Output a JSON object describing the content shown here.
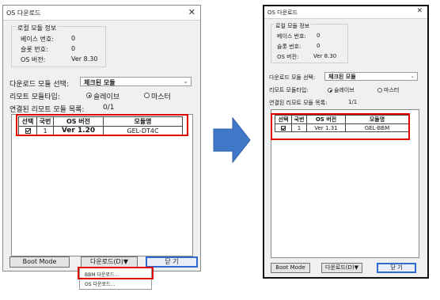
{
  "left": {
    "title": "OS 다운로드",
    "close": "✕",
    "local_group": "로컬 모듈 정보",
    "base_label": "베이스 번호:",
    "base_value": "0",
    "slot_label": "슬롯 번호:",
    "slot_value": "0",
    "os_label": "OS 버전:",
    "os_value": "Ver 8.30",
    "module_select_label": "다운로드 모듈 선택:",
    "module_select_value": "체크된 모듈",
    "remote_type_label": "리모트 모듈타입:",
    "radio_slave": "슬레이브",
    "radio_master": "마스터",
    "connected_label": "연결된 리모트 모듈 목록:",
    "connected_value": "0/1",
    "columns": [
      "선택",
      "국번",
      "OS 버전",
      "모듈명"
    ],
    "rows": [
      {
        "station": "1",
        "os": "Ver 1.20",
        "module": "GEL-DT4C"
      }
    ],
    "boot_button": "Boot Mode",
    "download_button": "다운로드(D)▼",
    "close_button": "닫 기",
    "menu_items": [
      "BBM 다운로드...",
      "OS 다운로드..."
    ]
  },
  "right": {
    "title": "OS 다운로드",
    "close": "✕",
    "local_group": "로컬 모듈 정보",
    "base_label": "베이스 번호:",
    "base_value": "0",
    "slot_label": "슬롯 번호:",
    "slot_value": "0",
    "os_label": "OS 버전:",
    "os_value": "Ver 8.30",
    "module_select_label": "다운로드 모듈 선택:",
    "module_select_value": "체크된 모듈",
    "remote_type_label": "리모트 모듈타입:",
    "radio_slave": "슬레이브",
    "radio_master": "마스터",
    "connected_label": "연결된 리모트 모듈 목록:",
    "connected_value": "1/1",
    "columns": [
      "선택",
      "국번",
      "OS 버전",
      "모듈명"
    ],
    "rows": [
      {
        "station": "1",
        "os": "Ver 1.31",
        "module": "GEL-BBM"
      }
    ],
    "boot_button": "Boot Mode",
    "download_button": "다운로드(D)▼",
    "close_button": "닫 기"
  },
  "colors": {
    "highlight": "#e00000",
    "arrow": "#3f78c6"
  },
  "icons": {
    "arrow": "right-arrow-icon",
    "checkbox": "checkbox-checked-icon"
  }
}
